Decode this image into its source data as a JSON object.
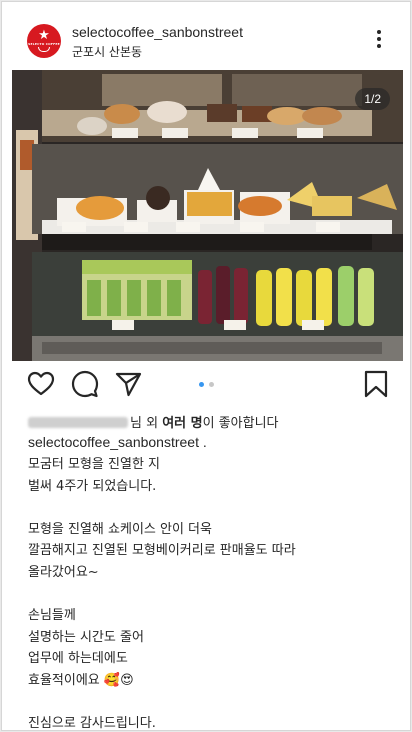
{
  "post": {
    "username": "selectocoffee_sanbonstreet",
    "location": "군포시 산본동",
    "image_counter": "1/2",
    "avatar_brand": "SELECTO COFFEE"
  },
  "likes": {
    "suffix": "님 외 ",
    "bold": "여러 명",
    "tail": "이 좋아합니다"
  },
  "caption": {
    "user": "selectocoffee_sanbonstreet .",
    "lines": [
      "모굼터 모형을 진열한 지",
      "벌써 4주가 되었습니다.",
      "",
      "모형을 진열해 쇼케이스 안이 더욱",
      "깔끔해지고 진열된 모형베이커리로  판매율도 따라",
      "올라갔어요~",
      "",
      "손님들께",
      "설명하는 시간도 줄어",
      "업무에  하는데에도",
      "효율적이에요 🥰😍",
      "",
      "진심으로 감사드립니다."
    ]
  },
  "colors": {
    "accent_blue": "#3897f0",
    "inactive_dot": "#c7c7c7",
    "brand_red": "#d71920"
  },
  "icons": [
    "heart-icon",
    "comment-icon",
    "share-icon",
    "bookmark-icon",
    "more-icon"
  ]
}
